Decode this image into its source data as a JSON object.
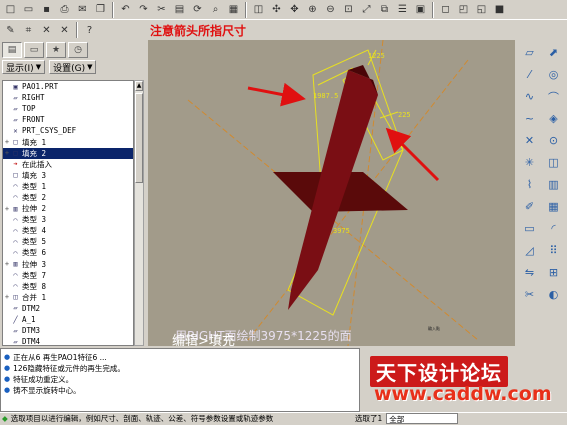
{
  "hint_top": "注意箭头所指尺寸",
  "panel": {
    "show_label": "显示(I)",
    "settings_label": "设置(G)"
  },
  "tree": [
    {
      "label": "PAO1.PRT",
      "icon": "part-icon",
      "exp": ""
    },
    {
      "label": "RIGHT",
      "icon": "datum-plane-icon",
      "exp": ""
    },
    {
      "label": "TOP",
      "icon": "datum-plane-icon",
      "exp": ""
    },
    {
      "label": "FRONT",
      "icon": "datum-plane-icon",
      "exp": ""
    },
    {
      "label": "PRT_CSYS_DEF",
      "icon": "csys-icon",
      "exp": ""
    },
    {
      "label": "填充 1",
      "icon": "fill-icon",
      "exp": "+"
    },
    {
      "label": "填充 2",
      "icon": "fill-icon",
      "exp": "+",
      "selected": true
    },
    {
      "label": "在此插入",
      "icon": "insert-here-icon",
      "exp": ""
    },
    {
      "label": "填充 3",
      "icon": "fill-icon",
      "exp": ""
    },
    {
      "label": "类型 1",
      "icon": "type-icon",
      "exp": ""
    },
    {
      "label": "类型 2",
      "icon": "type-icon",
      "exp": ""
    },
    {
      "label": "拉伸 2",
      "icon": "extrude-icon",
      "exp": "+"
    },
    {
      "label": "类型 3",
      "icon": "type-icon",
      "exp": ""
    },
    {
      "label": "类型 4",
      "icon": "type-icon",
      "exp": ""
    },
    {
      "label": "类型 5",
      "icon": "type-icon",
      "exp": ""
    },
    {
      "label": "类型 6",
      "icon": "type-icon",
      "exp": ""
    },
    {
      "label": "拉伸 3",
      "icon": "extrude-icon",
      "exp": "+"
    },
    {
      "label": "类型 7",
      "icon": "type-icon",
      "exp": ""
    },
    {
      "label": "类型 8",
      "icon": "type-icon",
      "exp": ""
    },
    {
      "label": "合并 1",
      "icon": "merge-icon",
      "exp": "+"
    },
    {
      "label": "DTM2",
      "icon": "datum-plane-icon",
      "exp": ""
    },
    {
      "label": "A_1",
      "icon": "axis-icon",
      "exp": ""
    },
    {
      "label": "DTM3",
      "icon": "datum-plane-icon",
      "exp": ""
    },
    {
      "label": "DTM4",
      "icon": "datum-plane-icon",
      "exp": ""
    }
  ],
  "viewport": {
    "dim1": "1987.5",
    "dim2": "1225",
    "dim3": "225",
    "dim4": "3975",
    "note_edit": "编辑>填充",
    "note_sketch": "用RIGHT面绘制3975*1225的面",
    "corner_text": "輪入點"
  },
  "messages": [
    "正在从6 再生PAO1特征6 ...",
    "126隐藏特征或元件的再生完成。",
    "特征成功重定义。",
    "铸不显示旋转中心。",
    "选取项目以进行编辑，例如尺寸、剖面、轨迹、公差、符号参数设置或轨迹参数"
  ],
  "status": {
    "select_label": "选取了1",
    "filter_value": "全部"
  },
  "logo": {
    "title": "天下设计论坛",
    "url": "www.caddw.com"
  },
  "watermark": "BBS.CHINADE.NET"
}
